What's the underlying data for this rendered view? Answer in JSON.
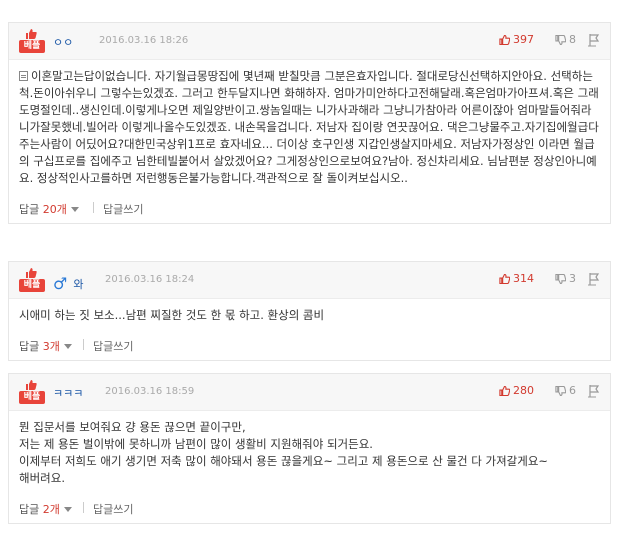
{
  "comments": [
    {
      "badge": "베플",
      "author": "ㅇㅇ",
      "male_icon": false,
      "date": "2016.03.16 18:26",
      "likes": "397",
      "dislikes": "8",
      "body": "이혼말고는답이없습니다. 자기월급몽땅집에 몇년째 받칠맛큼 그분은효자입니다. 절대로당신선택하지안아요. 선택하는척.돈이아쉬우니 그렇수는있겠죠. 그러고 한두달지나면 화해하자. 엄마가미안하다고전해달래.혹은엄마가아프셔.혹은 그래도명절인데..생신인데.이렇게나오면 제일양반이고.쌍놈일때는 니가사과해라 그냥니가참아라 어른이잖아 엄마말들어줘라 니가잘못했네.빌어라 이렇게나올수도있겠죠. 내손목을겁니다. 저남자 집이랑 연끗끊어요. 댁은그냥물주고.자기집에월급다주는사람이 어딨어요?대한민국상위1프로 효자네요... 더이상 호구인생 지갑인생살지마세요. 저남자가정상인 이라면 월급의 구십프로를 집에주고 님한테빌붙어서 살았겠어요? 그게정상인으로보여요?남아. 정신차리세요. 님남편분 정상인아니예요. 정상적인사고를하면 저런행동은불가능합니다.객관적으로 잘 돌이켜보십시오..",
      "reply_label": "답글",
      "reply_count": "20개",
      "write_label": "답글쓰기"
    },
    {
      "badge": "베플",
      "author": "와",
      "male_icon": true,
      "date": "2016.03.16 18:24",
      "likes": "314",
      "dislikes": "3",
      "body": "시애미 하는 짓 보소...남편 찌질한 것도 한 몫 하고. 환상의 콤비",
      "reply_label": "답글",
      "reply_count": "3개",
      "write_label": "답글쓰기"
    },
    {
      "badge": "베플",
      "author": "ㅋㅋㅋ",
      "male_icon": false,
      "date": "2016.03.16 18:59",
      "likes": "280",
      "dislikes": "6",
      "body_lines": [
        "뭔 집문서를 보여줘요 걍 용돈 끊으면 끝이구만,",
        "저는 제 용돈 벌이밖에 못하니까 남편이 많이 생활비 지원해줘야 되거든요.",
        "이제부터 저희도 애기 생기면 저축 많이 해야돼서 용돈 끊을게요~ 그리고 제 용돈으로 산 물건 다 가져갈게요~",
        "해버려요."
      ],
      "reply_label": "답글",
      "reply_count": "2개",
      "write_label": "답글쓰기"
    }
  ],
  "colors": {
    "accent_red": "#d23a2f",
    "badge_red": "#e8443a",
    "author_blue": "#1a56a6"
  }
}
